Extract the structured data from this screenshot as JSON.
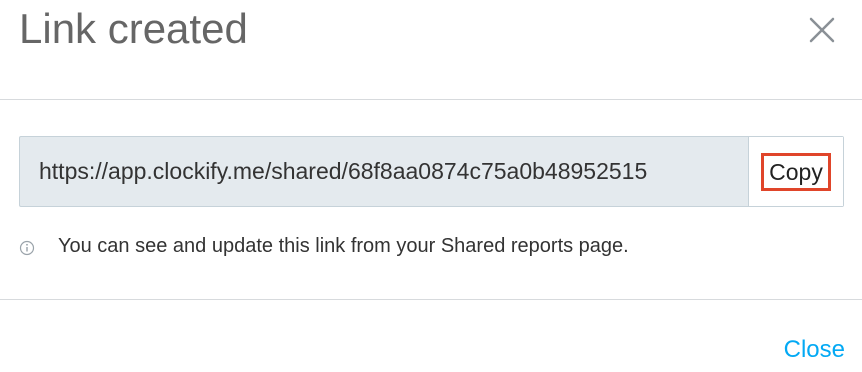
{
  "header": {
    "title": "Link created"
  },
  "link": {
    "url": "https://app.clockify.me/shared/68f8aa0874c75a0b48952515",
    "copy_label": "Copy"
  },
  "info": {
    "icon": "info-circle-icon",
    "text": "You can see and update this link from your Shared reports page."
  },
  "footer": {
    "close_label": "Close"
  },
  "colors": {
    "accent": "#03a9f4",
    "highlight": "#e0452a",
    "input_bg": "#e4eaee"
  }
}
